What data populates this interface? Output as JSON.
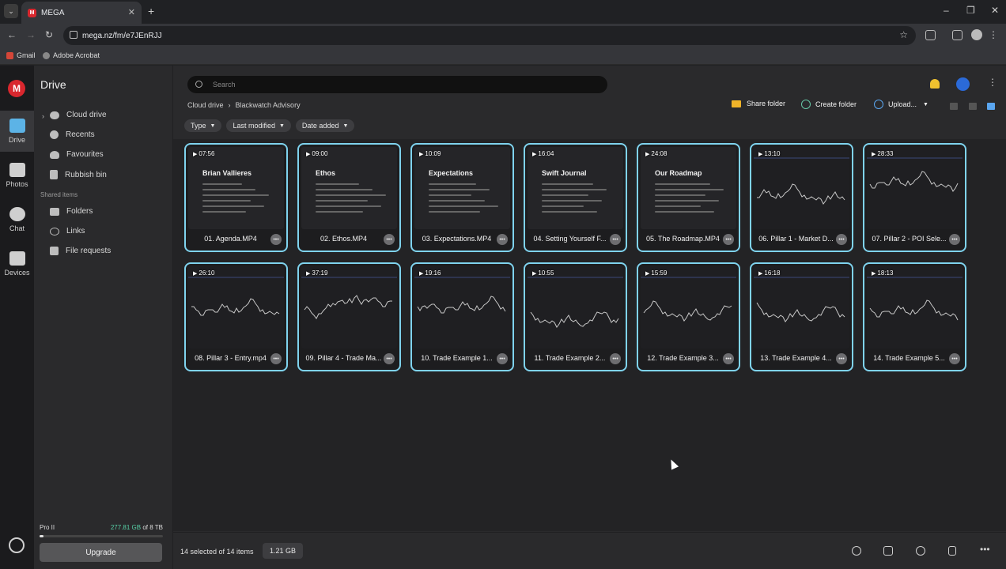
{
  "browser": {
    "tab_title": "MEGA",
    "url": "mega.nz/fm/e7JEnRJJ",
    "bookmarks": [
      "Gmail",
      "Adobe Acrobat"
    ]
  },
  "rail": {
    "items": [
      {
        "label": "Drive"
      },
      {
        "label": "Photos"
      },
      {
        "label": "Chat"
      },
      {
        "label": "Devices"
      }
    ]
  },
  "sidebar": {
    "title": "Drive",
    "items": [
      "Cloud drive",
      "Recents",
      "Favourites",
      "Rubbish bin"
    ],
    "shared_section": "Shared items",
    "shared_items": [
      "Folders",
      "Links",
      "File requests"
    ],
    "storage_plan": "Pro II",
    "storage_used": "277.81 GB",
    "storage_total": "of 8 TB",
    "storage_fraction": 0.034,
    "upgrade_label": "Upgrade"
  },
  "header": {
    "search_placeholder": "Search",
    "breadcrumb": [
      "Cloud drive",
      "Blackwatch Advisory"
    ],
    "share_folder": "Share folder",
    "create_folder": "Create folder",
    "upload": "Upload..."
  },
  "filters": [
    "Type",
    "Last modified",
    "Date added"
  ],
  "files": [
    {
      "duration": "07:56",
      "name": "01. Agenda.MP4",
      "thumb": "slide",
      "slide_title": "Brian Vallieres"
    },
    {
      "duration": "09:00",
      "name": "02. Ethos.MP4",
      "thumb": "slide",
      "slide_title": "Ethos"
    },
    {
      "duration": "10:09",
      "name": "03. Expectations.MP4",
      "thumb": "slide",
      "slide_title": "Expectations"
    },
    {
      "duration": "16:04",
      "name": "04. Setting Yourself F...",
      "thumb": "slide",
      "slide_title": "Swift Journal"
    },
    {
      "duration": "24:08",
      "name": "05. The Roadmap.MP4",
      "thumb": "slide",
      "slide_title": "Our Roadmap"
    },
    {
      "duration": "13:10",
      "name": "06. Pillar 1 - Market D...",
      "thumb": "chart"
    },
    {
      "duration": "28:33",
      "name": "07. Pillar 2 - POI Sele...",
      "thumb": "chart"
    },
    {
      "duration": "26:10",
      "name": "08. Pillar 3 - Entry.mp4",
      "thumb": "chart"
    },
    {
      "duration": "37:19",
      "name": "09. Pillar 4 - Trade Ma...",
      "thumb": "chart"
    },
    {
      "duration": "19:16",
      "name": "10. Trade Example 1...",
      "thumb": "chart"
    },
    {
      "duration": "10:55",
      "name": "11. Trade Example 2...",
      "thumb": "chart"
    },
    {
      "duration": "15:59",
      "name": "12. Trade Example 3...",
      "thumb": "chart"
    },
    {
      "duration": "16:18",
      "name": "13. Trade Example 4...",
      "thumb": "chart"
    },
    {
      "duration": "18:13",
      "name": "14. Trade Example 5...",
      "thumb": "chart"
    }
  ],
  "status": {
    "selection": "14 selected of 14 items",
    "size": "1.21 GB"
  }
}
